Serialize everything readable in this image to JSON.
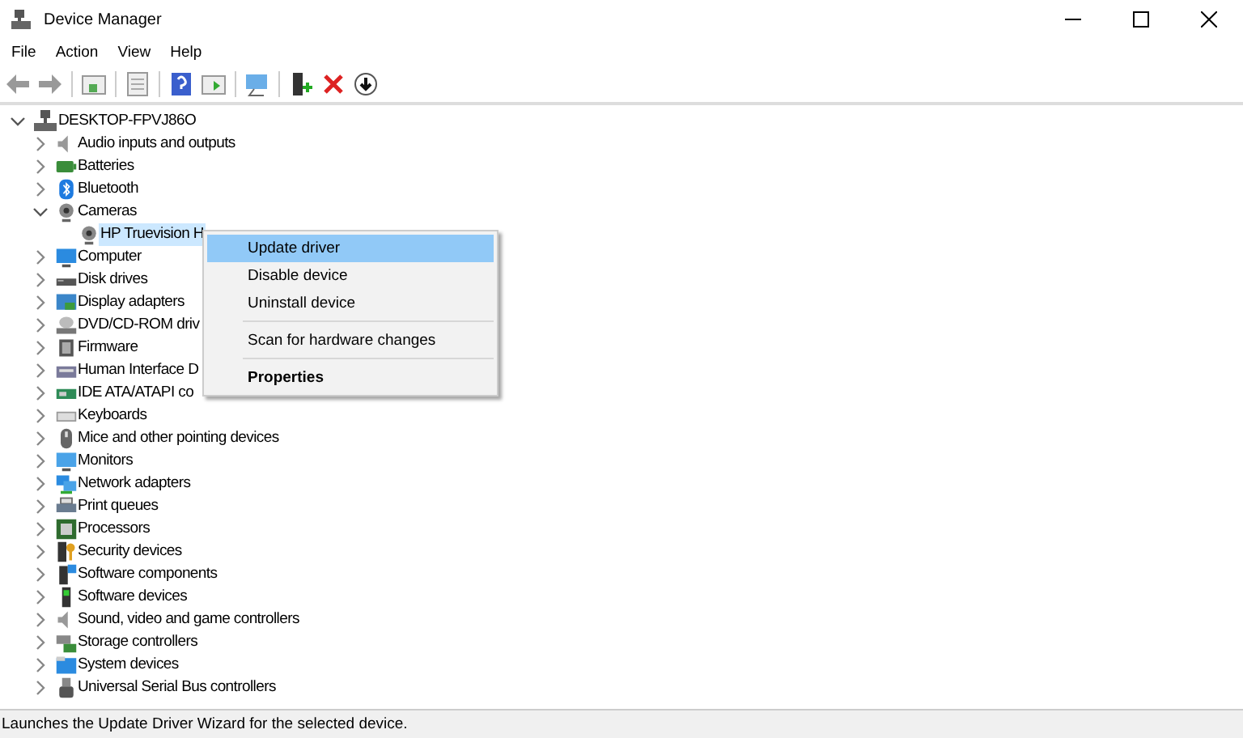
{
  "window": {
    "title": "Device Manager"
  },
  "menu_bar": [
    "File",
    "Action",
    "View",
    "Help"
  ],
  "tree": {
    "label": "DESKTOP-FPVJ86O",
    "expanded": true,
    "children": [
      {
        "label": "Audio inputs and outputs",
        "expanded": false,
        "selected": false
      },
      {
        "label": "Batteries",
        "expanded": false,
        "selected": false
      },
      {
        "label": "Bluetooth",
        "expanded": false,
        "selected": false
      },
      {
        "label": "Cameras",
        "expanded": true,
        "selected": false,
        "children": [
          {
            "label": "HP Truevision H",
            "selected": true
          }
        ]
      },
      {
        "label": "Computer",
        "expanded": false,
        "selected": false
      },
      {
        "label": "Disk drives",
        "expanded": false,
        "selected": false
      },
      {
        "label": "Display adapters",
        "expanded": false,
        "selected": false
      },
      {
        "label": "DVD/CD-ROM driv",
        "expanded": false,
        "selected": false
      },
      {
        "label": "Firmware",
        "expanded": false,
        "selected": false
      },
      {
        "label": "Human Interface D",
        "expanded": false,
        "selected": false
      },
      {
        "label": "IDE ATA/ATAPI co",
        "expanded": false,
        "selected": false
      },
      {
        "label": "Keyboards",
        "expanded": false,
        "selected": false
      },
      {
        "label": "Mice and other pointing devices",
        "expanded": false,
        "selected": false
      },
      {
        "label": "Monitors",
        "expanded": false,
        "selected": false
      },
      {
        "label": "Network adapters",
        "expanded": false,
        "selected": false
      },
      {
        "label": "Print queues",
        "expanded": false,
        "selected": false
      },
      {
        "label": "Processors",
        "expanded": false,
        "selected": false
      },
      {
        "label": "Security devices",
        "expanded": false,
        "selected": false
      },
      {
        "label": "Software components",
        "expanded": false,
        "selected": false
      },
      {
        "label": "Software devices",
        "expanded": false,
        "selected": false
      },
      {
        "label": "Sound, video and game controllers",
        "expanded": false,
        "selected": false
      },
      {
        "label": "Storage controllers",
        "expanded": false,
        "selected": false
      },
      {
        "label": "System devices",
        "expanded": false,
        "selected": false
      },
      {
        "label": "Universal Serial Bus controllers",
        "expanded": false,
        "selected": false
      }
    ]
  },
  "context_menu": {
    "groups": [
      [
        {
          "label": "Update driver",
          "selected": true,
          "default": false
        },
        {
          "label": "Disable device",
          "selected": false,
          "default": false
        },
        {
          "label": "Uninstall device",
          "selected": false,
          "default": false
        }
      ],
      [
        {
          "label": "Scan for hardware changes",
          "selected": false,
          "default": false
        }
      ],
      [
        {
          "label": "Properties",
          "selected": false,
          "default": true
        }
      ]
    ]
  },
  "status_bar": "Launches the Update Driver Wizard for the selected device."
}
